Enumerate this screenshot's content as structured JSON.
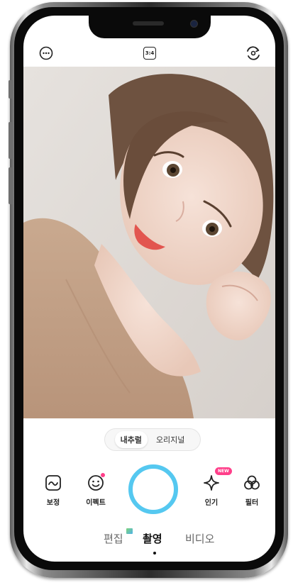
{
  "top_bar": {
    "more_icon": "more-icon",
    "ratio_label": "3:4",
    "switch_camera_icon": "switch-camera-icon"
  },
  "photo": {
    "description_icon": "camera-preview"
  },
  "style_toggle": {
    "options": [
      "내추럴",
      "오리지널"
    ],
    "selected": "내추럴"
  },
  "tools": {
    "retouch": {
      "label": "보정",
      "icon": "retouch-icon"
    },
    "effect": {
      "label": "이펙트",
      "icon": "effect-icon"
    },
    "popular": {
      "label": "인기",
      "icon": "sparkle-icon",
      "badge": "NEW"
    },
    "filter": {
      "label": "필터",
      "icon": "filter-icon"
    }
  },
  "modes": {
    "items": [
      "편집",
      "촬영",
      "비디오"
    ],
    "active": "촬영"
  },
  "colors": {
    "shutter_ring": "#55c8f0",
    "badge": "#ff3f8a"
  }
}
